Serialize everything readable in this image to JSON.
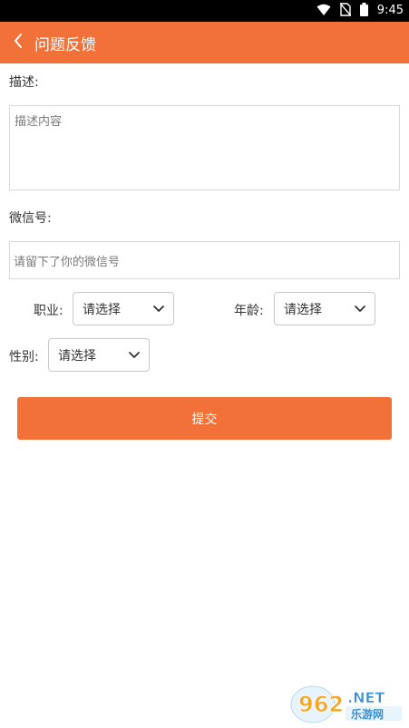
{
  "status_bar": {
    "time": "9:45",
    "icons": [
      "wifi-icon",
      "no-sim-icon",
      "battery-icon"
    ]
  },
  "header": {
    "title": "问题反馈",
    "back_icon": "chevron-left-icon",
    "color": "#F27138"
  },
  "form": {
    "description_label": "描述:",
    "description_placeholder": "描述内容",
    "wechat_label": "微信号:",
    "wechat_placeholder": "请留下了你的微信号",
    "occupation_label": "职业:",
    "occupation_value": "请选择",
    "age_label": "年龄:",
    "age_value": "请选择",
    "gender_label": "性别:",
    "gender_value": "请选择",
    "submit_label": "提交"
  },
  "watermark": {
    "brand": "962.NET",
    "subtitle": "乐游网"
  }
}
